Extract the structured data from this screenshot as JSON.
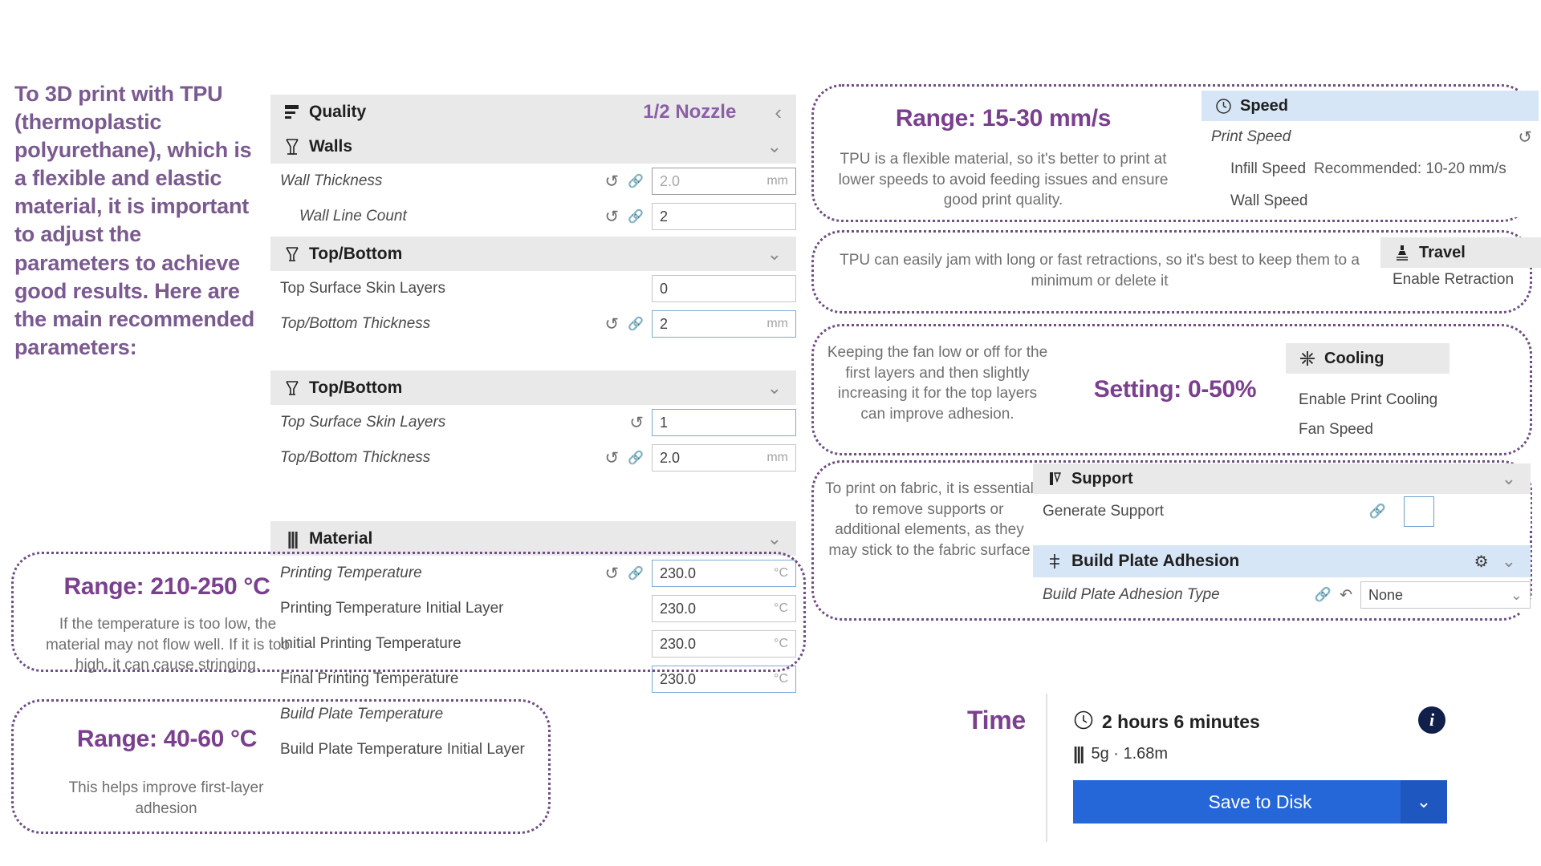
{
  "intro": {
    "text": "To 3D print with TPU (thermoplastic polyurethane), which is a flexible and elastic material, it is important to adjust the parameters to achieve good results. Here are the main recommended parameters:"
  },
  "accent": {
    "purple": "#7b3f8f",
    "intro_purple": "#7a5a90",
    "blue": "#2566d8",
    "panel_blue": "#d6e6f6"
  },
  "left_panel": {
    "quality": {
      "icon": "quality-bars-icon",
      "title": "Quality",
      "badge": "1/2 Nozzle",
      "chevron": "‹"
    },
    "walls": {
      "icon": "walls-icon",
      "title": "Walls",
      "chevron": "⌄",
      "rows": [
        {
          "label": "Wall Thickness",
          "value": "2.0",
          "unit": "mm",
          "italic": true,
          "indent": false,
          "dim": true,
          "selected": false,
          "has_revert": true,
          "has_link": true
        },
        {
          "label": "Wall Line Count",
          "value": "2",
          "unit": "",
          "italic": true,
          "indent": true,
          "dim": false,
          "selected": false,
          "has_revert": true,
          "has_link": true
        }
      ]
    },
    "topbottom_1": {
      "icon": "topbottom-icon",
      "title": "Top/Bottom",
      "chevron": "⌄",
      "rows": [
        {
          "label": "Top Surface Skin Layers",
          "value": "0",
          "unit": "",
          "italic": false,
          "indent": false,
          "dim": false,
          "selected": false,
          "has_revert": false,
          "has_link": false
        },
        {
          "label": "Top/Bottom Thickness",
          "value": "2",
          "unit": "mm",
          "italic": true,
          "indent": false,
          "dim": false,
          "selected": true,
          "has_revert": true,
          "has_link": true
        }
      ]
    },
    "topbottom_2": {
      "icon": "topbottom-icon",
      "title": "Top/Bottom",
      "chevron": "⌄",
      "rows": [
        {
          "label": "Top Surface Skin Layers",
          "value": "1",
          "unit": "",
          "italic": true,
          "indent": false,
          "dim": false,
          "selected": true,
          "has_revert": true,
          "has_link": false
        },
        {
          "label": "Top/Bottom Thickness",
          "value": "2.0",
          "unit": "mm",
          "italic": true,
          "indent": false,
          "dim": false,
          "selected": false,
          "has_revert": true,
          "has_link": true
        }
      ]
    },
    "material": {
      "icon": "material-icon",
      "title": "Material",
      "chevron": "⌄",
      "rows": [
        {
          "label": "Printing Temperature",
          "value": "230.0",
          "unit": "°C",
          "italic": true,
          "indent": false,
          "dim": false,
          "selected": true,
          "has_revert": true,
          "has_link": true
        },
        {
          "label": "Printing Temperature Initial Layer",
          "value": "230.0",
          "unit": "°C",
          "italic": false,
          "indent": false,
          "dim": false,
          "selected": false,
          "has_revert": false,
          "has_link": false
        },
        {
          "label": "Initial Printing Temperature",
          "value": "230.0",
          "unit": "°C",
          "italic": false,
          "indent": false,
          "dim": false,
          "selected": false,
          "has_revert": false,
          "has_link": false
        },
        {
          "label": "Final Printing Temperature",
          "value": "230.0",
          "unit": "°C",
          "italic": false,
          "indent": false,
          "dim": false,
          "selected": true,
          "has_revert": false,
          "has_link": false
        },
        {
          "label": "Build Plate Temperature",
          "value": "",
          "unit": "",
          "italic": true,
          "indent": false,
          "dim": false,
          "selected": false,
          "has_revert": false,
          "has_link": false
        },
        {
          "label": "Build Plate Temperature Initial Layer",
          "value": "",
          "unit": "",
          "italic": false,
          "indent": false,
          "dim": false,
          "selected": false,
          "has_revert": false,
          "has_link": false
        }
      ]
    }
  },
  "callouts": {
    "temperature": {
      "heading": "Range: 210-250 °C",
      "body": "If the temperature is too low, the material may not flow well. If it is too high, it can cause stringing."
    },
    "bed": {
      "heading": "Range: 40-60 °C",
      "body": "This helps improve first-layer adhesion"
    },
    "speed": {
      "heading": "Range: 15-30 mm/s",
      "body": "TPU is a flexible material, so it's better to print at lower speeds to avoid feeding issues and ensure good print quality."
    },
    "travel": {
      "body": "TPU can easily jam with long or fast retractions, so it's best to keep them to a minimum or delete it"
    },
    "cooling": {
      "heading": "Setting: 0-50%",
      "body": "Keeping the fan low or off for the first layers and then slightly increasing it for the top layers can improve adhesion."
    },
    "support": {
      "body": "To print on fabric, it is essential to remove supports or additional elements, as they may stick to the fabric surface"
    }
  },
  "right_panel": {
    "speed": {
      "icon": "speedometer-icon",
      "title": "Speed",
      "rows": [
        {
          "label": "Print Speed",
          "italic": true,
          "indent": false,
          "has_revert": true,
          "note": ""
        },
        {
          "label": "Infill Speed",
          "italic": false,
          "indent": true,
          "has_revert": false,
          "note": "Recommended: 10-20 mm/s"
        },
        {
          "label": "Wall Speed",
          "italic": false,
          "indent": true,
          "has_revert": false,
          "note": ""
        }
      ]
    },
    "travel": {
      "icon": "travel-icon",
      "title": "Travel",
      "rows": [
        {
          "label": "Enable Retraction"
        }
      ]
    },
    "cooling": {
      "icon": "fan-icon",
      "title": "Cooling",
      "rows": [
        {
          "label": "Enable Print Cooling"
        },
        {
          "label": "Fan Speed"
        }
      ]
    },
    "support": {
      "icon": "support-icon",
      "title": "Support",
      "chevron": "⌄",
      "rows": [
        {
          "label": "Generate Support",
          "checkbox": true,
          "checked": false,
          "has_link": true
        }
      ]
    },
    "adhesion": {
      "icon": "adhesion-icon",
      "title": "Build Plate Adhesion",
      "gear": "gear-icon",
      "chevron": "⌄",
      "rows": [
        {
          "label": "Build Plate Adhesion Type",
          "value": "None",
          "has_link": true,
          "has_revert": true
        }
      ]
    }
  },
  "time_panel": {
    "label": "Time",
    "duration": "2 hours 6 minutes",
    "material": "5g · 1.68m",
    "clock_icon": "clock-icon",
    "material_icon": "material-icon",
    "info_icon": "info-icon",
    "save_label": "Save to Disk",
    "save_dropdown_icon": "chevron-down-icon"
  }
}
